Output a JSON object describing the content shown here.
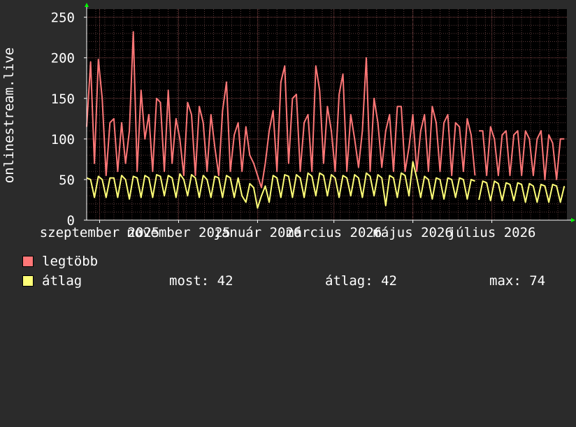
{
  "chart_data": {
    "type": "line",
    "ylabel": "onlinestream.live",
    "ylim": [
      0,
      260
    ],
    "yticks": [
      0,
      50,
      100,
      150,
      200,
      250
    ],
    "grid": true,
    "xlim": [
      "2025-08-22",
      "2026-08-28"
    ],
    "x_tick_labels": [
      {
        "date": "2025-09-01",
        "label": "szeptember 2025"
      },
      {
        "date": "2025-11-01",
        "label": "november 2025"
      },
      {
        "date": "2026-01-01",
        "label": "január 2026"
      },
      {
        "date": "2026-03-01",
        "label": "március 2026"
      },
      {
        "date": "2026-05-01",
        "label": "május 2026"
      },
      {
        "date": "2026-07-01",
        "label": "július 2026"
      }
    ],
    "colors": {
      "background": "#2b2b2b",
      "plot_bg": "#000000",
      "grid": "#5a3a3a",
      "axis": "#ffffff",
      "arrow": "#00ff00"
    },
    "series": [
      {
        "name": "legtöbb",
        "color": "#ff7777",
        "x": [
          "2025-08-22",
          "2025-08-25",
          "2025-08-28",
          "2025-08-31",
          "2025-09-03",
          "2025-09-06",
          "2025-09-09",
          "2025-09-12",
          "2025-09-15",
          "2025-09-18",
          "2025-09-21",
          "2025-09-24",
          "2025-09-27",
          "2025-09-30",
          "2025-10-03",
          "2025-10-06",
          "2025-10-09",
          "2025-10-12",
          "2025-10-15",
          "2025-10-18",
          "2025-10-21",
          "2025-10-24",
          "2025-10-27",
          "2025-10-30",
          "2025-11-02",
          "2025-11-05",
          "2025-11-08",
          "2025-11-11",
          "2025-11-14",
          "2025-11-17",
          "2025-11-20",
          "2025-11-23",
          "2025-11-26",
          "2025-11-29",
          "2025-12-02",
          "2025-12-05",
          "2025-12-08",
          "2025-12-11",
          "2025-12-14",
          "2025-12-17",
          "2025-12-20",
          "2025-12-23",
          "2025-12-26",
          "2025-12-29",
          "2026-01-01",
          "2026-01-04",
          "2026-01-07",
          "2026-01-10",
          "2026-01-13",
          "2026-01-16",
          "2026-01-19",
          "2026-01-22",
          "2026-01-25",
          "2026-01-28",
          "2026-01-31",
          "2026-02-03",
          "2026-02-06",
          "2026-02-09",
          "2026-02-12",
          "2026-02-15",
          "2026-02-18",
          "2026-02-21",
          "2026-02-24",
          "2026-02-27",
          "2026-03-02",
          "2026-03-05",
          "2026-03-08",
          "2026-03-11",
          "2026-03-14",
          "2026-03-17",
          "2026-03-20",
          "2026-03-23",
          "2026-03-26",
          "2026-03-29",
          "2026-04-01",
          "2026-04-04",
          "2026-04-07",
          "2026-04-10",
          "2026-04-13",
          "2026-04-16",
          "2026-04-19",
          "2026-04-22",
          "2026-04-25",
          "2026-04-28",
          "2026-05-01",
          "2026-05-04",
          "2026-05-07",
          "2026-05-10",
          "2026-05-13",
          "2026-05-16",
          "2026-05-19",
          "2026-05-22",
          "2026-05-25",
          "2026-05-28",
          "2026-05-31",
          "2026-06-03",
          "2026-06-06",
          "2026-06-09",
          "2026-06-12",
          "2026-06-15",
          "2026-06-18",
          "2026-06-21",
          "2026-06-24",
          "2026-06-27",
          "2026-06-30",
          "2026-07-03",
          "2026-07-06",
          "2026-07-09",
          "2026-07-12",
          "2026-07-15",
          "2026-07-18",
          "2026-07-21",
          "2026-07-24",
          "2026-07-27",
          "2026-07-30",
          "2026-08-02",
          "2026-08-05",
          "2026-08-08",
          "2026-08-11",
          "2026-08-14",
          "2026-08-17",
          "2026-08-20",
          "2026-08-23",
          "2026-08-26"
        ],
        "y": [
          115,
          195,
          70,
          198,
          150,
          55,
          120,
          125,
          60,
          120,
          70,
          110,
          232,
          60,
          160,
          100,
          130,
          60,
          150,
          145,
          60,
          160,
          70,
          125,
          100,
          55,
          145,
          130,
          55,
          140,
          120,
          60,
          130,
          90,
          55,
          135,
          170,
          60,
          105,
          120,
          60,
          115,
          80,
          70,
          55,
          40,
          70,
          110,
          135,
          60,
          170,
          190,
          70,
          150,
          155,
          60,
          120,
          130,
          60,
          190,
          160,
          70,
          140,
          110,
          60,
          155,
          180,
          60,
          130,
          100,
          65,
          110,
          200,
          60,
          150,
          120,
          65,
          110,
          130,
          60,
          140,
          140,
          60,
          90,
          130,
          60,
          110,
          130,
          60,
          140,
          120,
          60,
          120,
          130,
          55,
          120,
          115,
          60,
          125,
          105,
          55,
          110,
          110,
          55,
          115,
          100,
          55,
          105,
          110,
          55,
          105,
          110,
          55,
          110,
          100,
          55,
          100,
          110,
          50,
          105,
          95,
          50,
          100,
          100
        ],
        "breaks_after_index": [
          100
        ]
      },
      {
        "name": "átlag",
        "color": "#ffff77",
        "x": [
          "2025-08-22",
          "2025-08-25",
          "2025-08-28",
          "2025-08-31",
          "2025-09-03",
          "2025-09-06",
          "2025-09-09",
          "2025-09-12",
          "2025-09-15",
          "2025-09-18",
          "2025-09-21",
          "2025-09-24",
          "2025-09-27",
          "2025-09-30",
          "2025-10-03",
          "2025-10-06",
          "2025-10-09",
          "2025-10-12",
          "2025-10-15",
          "2025-10-18",
          "2025-10-21",
          "2025-10-24",
          "2025-10-27",
          "2025-10-30",
          "2025-11-02",
          "2025-11-05",
          "2025-11-08",
          "2025-11-11",
          "2025-11-14",
          "2025-11-17",
          "2025-11-20",
          "2025-11-23",
          "2025-11-26",
          "2025-11-29",
          "2025-12-02",
          "2025-12-05",
          "2025-12-08",
          "2025-12-11",
          "2025-12-14",
          "2025-12-17",
          "2025-12-20",
          "2025-12-23",
          "2025-12-26",
          "2025-12-29",
          "2026-01-01",
          "2026-01-04",
          "2026-01-07",
          "2026-01-10",
          "2026-01-13",
          "2026-01-16",
          "2026-01-19",
          "2026-01-22",
          "2026-01-25",
          "2026-01-28",
          "2026-01-31",
          "2026-02-03",
          "2026-02-06",
          "2026-02-09",
          "2026-02-12",
          "2026-02-15",
          "2026-02-18",
          "2026-02-21",
          "2026-02-24",
          "2026-02-27",
          "2026-03-02",
          "2026-03-05",
          "2026-03-08",
          "2026-03-11",
          "2026-03-14",
          "2026-03-17",
          "2026-03-20",
          "2026-03-23",
          "2026-03-26",
          "2026-03-29",
          "2026-04-01",
          "2026-04-04",
          "2026-04-07",
          "2026-04-10",
          "2026-04-13",
          "2026-04-16",
          "2026-04-19",
          "2026-04-22",
          "2026-04-25",
          "2026-04-28",
          "2026-05-01",
          "2026-05-04",
          "2026-05-07",
          "2026-05-10",
          "2026-05-13",
          "2026-05-16",
          "2026-05-19",
          "2026-05-22",
          "2026-05-25",
          "2026-05-28",
          "2026-05-31",
          "2026-06-03",
          "2026-06-06",
          "2026-06-09",
          "2026-06-12",
          "2026-06-15",
          "2026-06-18",
          "2026-06-21",
          "2026-06-24",
          "2026-06-27",
          "2026-06-30",
          "2026-07-03",
          "2026-07-06",
          "2026-07-09",
          "2026-07-12",
          "2026-07-15",
          "2026-07-18",
          "2026-07-21",
          "2026-07-24",
          "2026-07-27",
          "2026-07-30",
          "2026-08-02",
          "2026-08-05",
          "2026-08-08",
          "2026-08-11",
          "2026-08-14",
          "2026-08-17",
          "2026-08-20",
          "2026-08-23",
          "2026-08-26"
        ],
        "y": [
          52,
          50,
          28,
          54,
          50,
          28,
          52,
          52,
          28,
          55,
          50,
          26,
          54,
          52,
          28,
          55,
          52,
          28,
          56,
          54,
          30,
          55,
          52,
          28,
          57,
          50,
          30,
          56,
          52,
          28,
          55,
          50,
          28,
          54,
          52,
          28,
          55,
          52,
          28,
          52,
          30,
          22,
          45,
          40,
          15,
          30,
          42,
          22,
          55,
          52,
          28,
          56,
          54,
          28,
          56,
          52,
          28,
          58,
          54,
          30,
          58,
          55,
          30,
          56,
          52,
          28,
          55,
          52,
          30,
          56,
          52,
          28,
          58,
          54,
          30,
          56,
          52,
          18,
          55,
          52,
          28,
          58,
          55,
          30,
          72,
          52,
          28,
          54,
          50,
          26,
          52,
          50,
          26,
          52,
          50,
          28,
          52,
          50,
          26,
          50,
          48,
          25,
          48,
          46,
          24,
          48,
          45,
          24,
          46,
          44,
          24,
          46,
          44,
          22,
          45,
          42,
          22,
          44,
          42,
          22,
          44,
          42,
          22,
          42
        ],
        "breaks_after_index": [
          100
        ]
      }
    ],
    "legend": {
      "placement": "bottom-left",
      "stats_labels": {
        "current": "most:",
        "average": "átlag:",
        "max": "max:"
      },
      "stats": {
        "current": "42",
        "average": "42",
        "max": "74"
      }
    }
  }
}
